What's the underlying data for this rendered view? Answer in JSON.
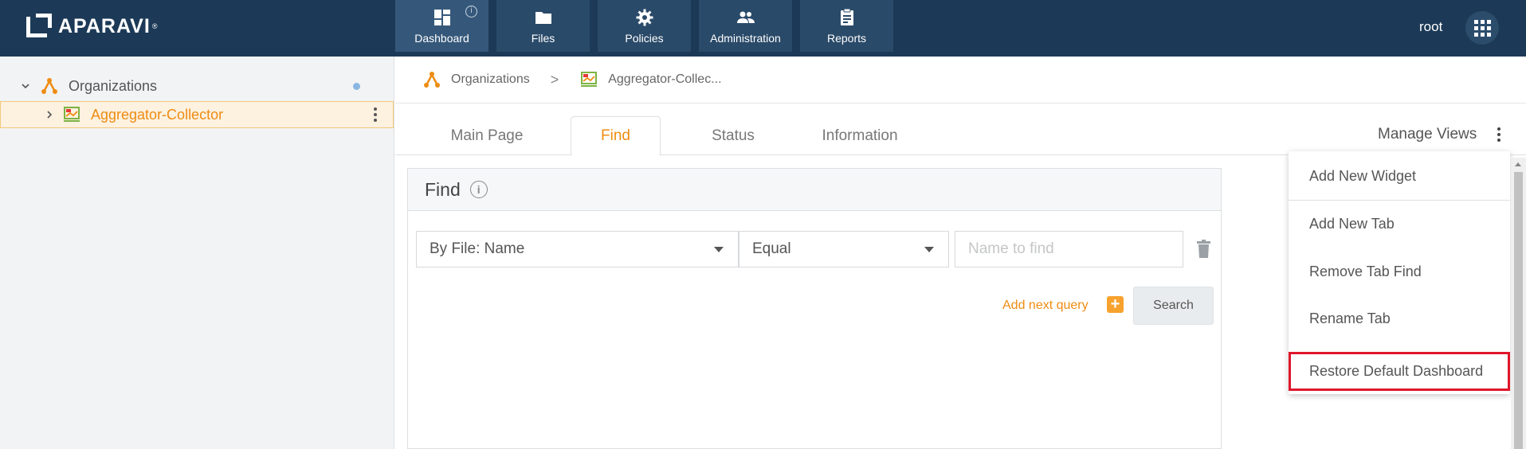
{
  "app": {
    "logo_text": "APARAVI",
    "logo_reg": "®"
  },
  "nav": {
    "items": [
      {
        "label": "Dashboard",
        "icon": "dashboard-icon",
        "active": true
      },
      {
        "label": "Files",
        "icon": "folder-icon"
      },
      {
        "label": "Policies",
        "icon": "gear-icon"
      },
      {
        "label": "Administration",
        "icon": "users-icon"
      },
      {
        "label": "Reports",
        "icon": "clipboard-icon"
      }
    ],
    "info_glyph": "i"
  },
  "user": {
    "name": "root"
  },
  "sidebar": {
    "items": [
      {
        "label": "Organizations",
        "expanded": true
      },
      {
        "label": "Aggregator-Collector",
        "selected": true
      }
    ]
  },
  "breadcrumb": {
    "items": [
      {
        "label": "Organizations"
      },
      {
        "label": "Aggregator-Collec..."
      }
    ],
    "separator": ">"
  },
  "tabs": {
    "items": [
      {
        "label": "Main Page"
      },
      {
        "label": "Find",
        "active": true
      },
      {
        "label": "Status"
      },
      {
        "label": "Information"
      }
    ],
    "manage_views": "Manage Views"
  },
  "find_widget": {
    "title": "Find",
    "info_glyph": "i",
    "field_select": "By File: Name",
    "operator_select": "Equal",
    "name_placeholder": "Name to find",
    "add_next_label": "Add next query",
    "plus_glyph": "+",
    "search_label": "Search"
  },
  "menu": {
    "items": [
      {
        "label": "Add New Widget"
      },
      {
        "label": "Add New Tab"
      },
      {
        "label": "Remove Tab Find"
      },
      {
        "label": "Rename Tab"
      },
      {
        "label": "Restore Default Dashboard",
        "highlighted": true
      }
    ]
  },
  "colors": {
    "topbar": "#1c3a57",
    "accent": "#ee8c12",
    "highlight_border": "#e0162b"
  }
}
